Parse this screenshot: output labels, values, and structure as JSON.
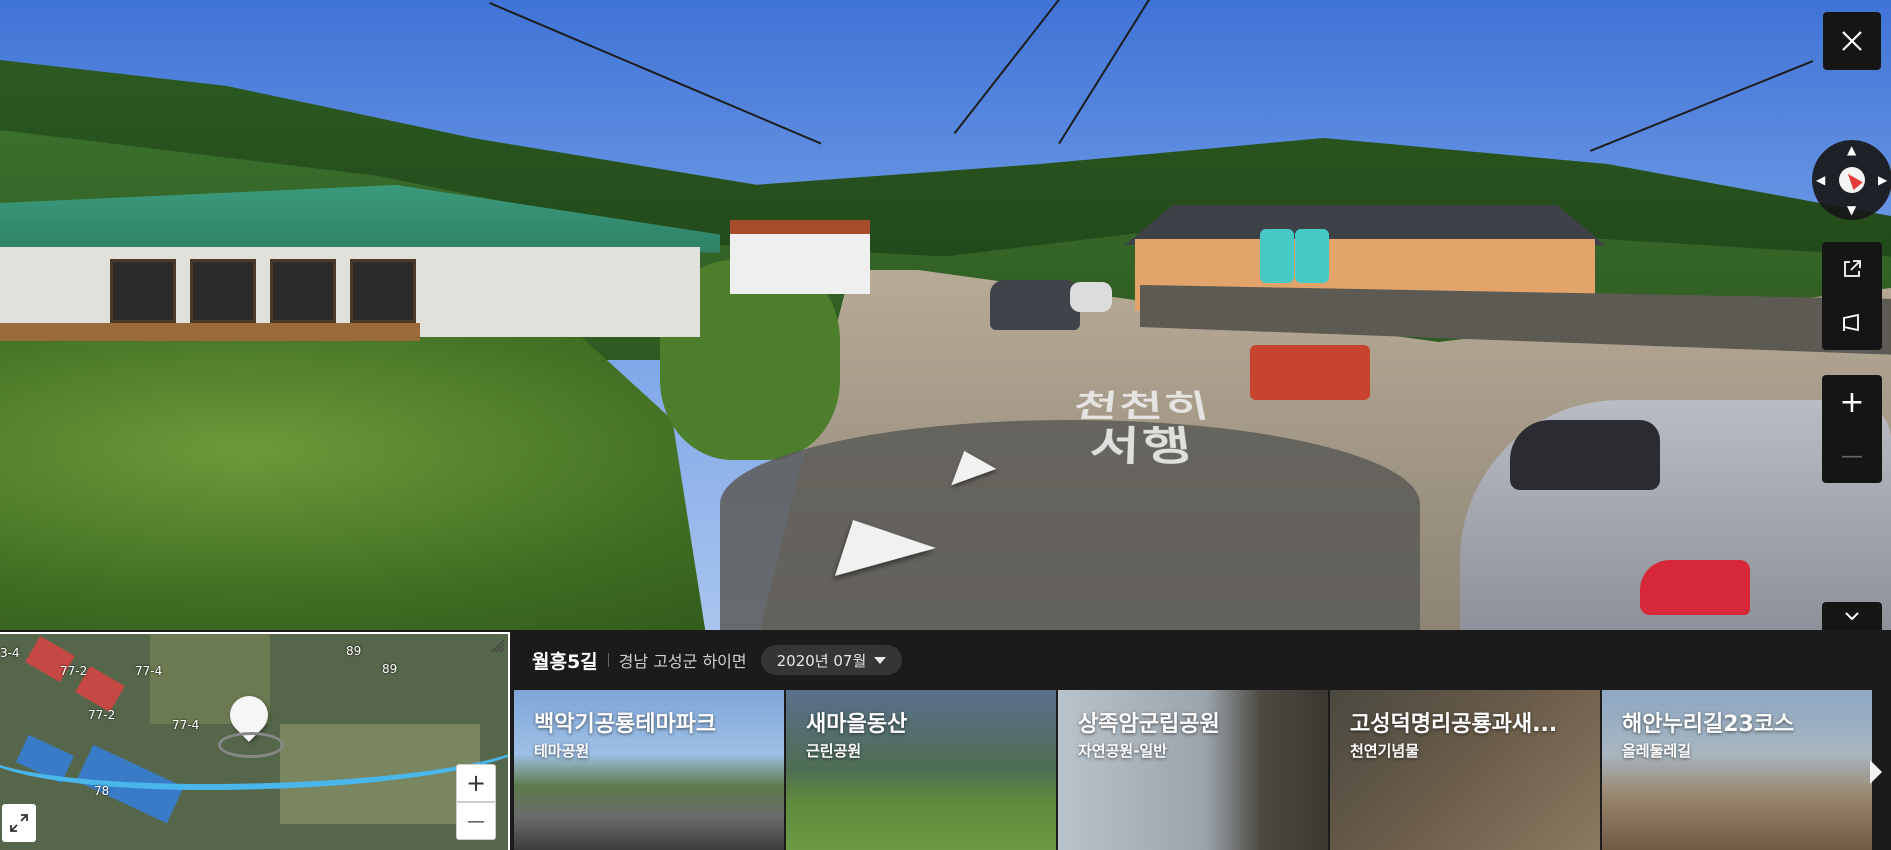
{
  "panorama": {
    "road_marking": [
      "천천히",
      "서행"
    ]
  },
  "controls": {
    "close_icon": "close-icon",
    "compass_icon": "compass-icon",
    "share_icon": "share-icon",
    "report_icon": "report-icon",
    "zoom_in": "+",
    "zoom_out": "—",
    "collapse_icon": "chevron-down-icon"
  },
  "minimap": {
    "labels": [
      "3-4",
      "77-2",
      "77-4",
      "77-2",
      "77-4",
      "89",
      "89",
      "78"
    ],
    "zoom_in": "+",
    "zoom_out": "—",
    "expand_icon": "expand-icon",
    "resize_icon": "resize-handle-icon"
  },
  "location": {
    "title": "월흥5길",
    "address": "경남 고성군 하이면",
    "date": "2020년 07월"
  },
  "nearby": [
    {
      "title": "백악기공룡테마파크",
      "category": "테마공원"
    },
    {
      "title": "새마을동산",
      "category": "근린공원"
    },
    {
      "title": "상족암군립공원",
      "category": "자연공원-일반"
    },
    {
      "title": "고성덕명리공룡과새...",
      "category": "천연기념물"
    },
    {
      "title": "해안누리길23코스",
      "category": "올레둘레길"
    }
  ],
  "colors": {
    "panel_bg": "#151515",
    "bottom_bg": "#1b1b1b",
    "route": "#49b6ec",
    "compass_needle": "#e53935"
  }
}
